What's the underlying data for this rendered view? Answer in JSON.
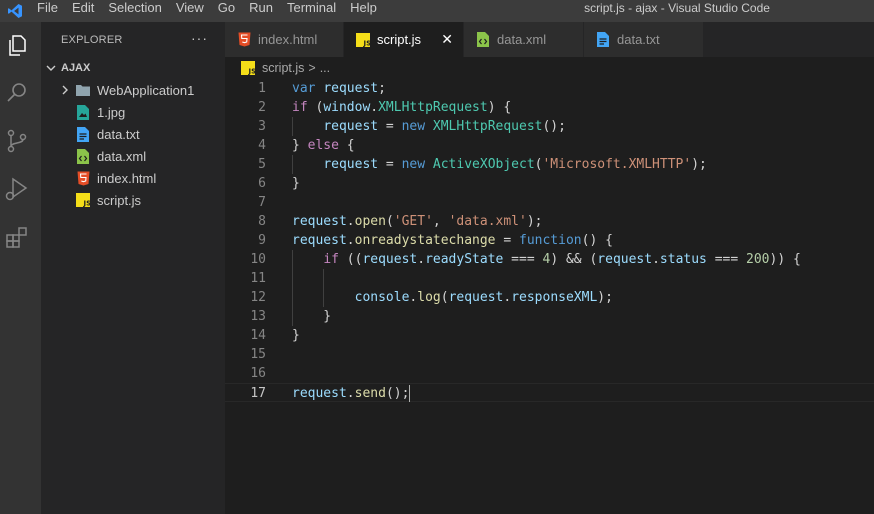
{
  "window": {
    "title": "script.js - ajax - Visual Studio Code"
  },
  "menu": [
    "File",
    "Edit",
    "Selection",
    "View",
    "Go",
    "Run",
    "Terminal",
    "Help"
  ],
  "activity": [
    "explorer-icon",
    "search-icon",
    "source-control-icon",
    "run-debug-icon",
    "extensions-icon"
  ],
  "explorer": {
    "title": "EXPLORER",
    "more": "···",
    "folder": "AJAX",
    "items": [
      {
        "label": "WebApplication1",
        "icon": "folder-icon",
        "color": "#c09553"
      },
      {
        "label": "1.jpg",
        "icon": "image-file-icon",
        "color": "#26a69a"
      },
      {
        "label": "data.txt",
        "icon": "text-file-icon",
        "color": "#42a5f5"
      },
      {
        "label": "data.xml",
        "icon": "xml-file-icon",
        "color": "#8bc34a"
      },
      {
        "label": "index.html",
        "icon": "html-file-icon",
        "color": "#e44d26"
      },
      {
        "label": "script.js",
        "icon": "js-file-icon",
        "color": "#f5de19"
      }
    ]
  },
  "tabs": [
    {
      "label": "index.html",
      "icon": "html-file-icon",
      "active": false
    },
    {
      "label": "script.js",
      "icon": "js-file-icon",
      "active": true,
      "close": "✕"
    },
    {
      "label": "data.xml",
      "icon": "xml-file-icon",
      "active": false
    },
    {
      "label": "data.txt",
      "icon": "text-file-icon",
      "active": false
    }
  ],
  "breadcrumb": {
    "file": "script.js",
    "sep": ">",
    "rest": "..."
  },
  "editor": {
    "current_line": 17,
    "lines": [
      {
        "n": "1",
        "t": [
          [
            "kw",
            "var"
          ],
          [
            "pun",
            " "
          ],
          [
            "var",
            "request"
          ],
          [
            "pun",
            ";"
          ]
        ]
      },
      {
        "n": "2",
        "t": [
          [
            "ctrl",
            "if"
          ],
          [
            "pun",
            " ("
          ],
          [
            "var",
            "window"
          ],
          [
            "pun",
            "."
          ],
          [
            "cls",
            "XMLHttpRequest"
          ],
          [
            "pun",
            ") {"
          ]
        ]
      },
      {
        "n": "3",
        "t": [
          [
            "pun",
            "    "
          ],
          [
            "var",
            "request"
          ],
          [
            "pun",
            " = "
          ],
          [
            "kw",
            "new"
          ],
          [
            "pun",
            " "
          ],
          [
            "cls",
            "XMLHttpRequest"
          ],
          [
            "pun",
            "();"
          ]
        ]
      },
      {
        "n": "4",
        "t": [
          [
            "pun",
            "} "
          ],
          [
            "ctrl",
            "else"
          ],
          [
            "pun",
            " {"
          ]
        ]
      },
      {
        "n": "5",
        "t": [
          [
            "pun",
            "    "
          ],
          [
            "var",
            "request"
          ],
          [
            "pun",
            " = "
          ],
          [
            "kw",
            "new"
          ],
          [
            "pun",
            " "
          ],
          [
            "cls",
            "ActiveXObject"
          ],
          [
            "pun",
            "("
          ],
          [
            "str",
            "'Microsoft.XMLHTTP'"
          ],
          [
            "pun",
            ");"
          ]
        ]
      },
      {
        "n": "6",
        "t": [
          [
            "pun",
            "}"
          ]
        ]
      },
      {
        "n": "7",
        "t": []
      },
      {
        "n": "8",
        "t": [
          [
            "var",
            "request"
          ],
          [
            "pun",
            "."
          ],
          [
            "fn",
            "open"
          ],
          [
            "pun",
            "("
          ],
          [
            "str",
            "'GET'"
          ],
          [
            "pun",
            ", "
          ],
          [
            "str",
            "'data.xml'"
          ],
          [
            "pun",
            ");"
          ]
        ]
      },
      {
        "n": "9",
        "t": [
          [
            "var",
            "request"
          ],
          [
            "pun",
            "."
          ],
          [
            "fn",
            "onreadystatechange"
          ],
          [
            "pun",
            " = "
          ],
          [
            "kw",
            "function"
          ],
          [
            "pun",
            "() {"
          ]
        ]
      },
      {
        "n": "10",
        "t": [
          [
            "pun",
            "    "
          ],
          [
            "ctrl",
            "if"
          ],
          [
            "pun",
            " (("
          ],
          [
            "var",
            "request"
          ],
          [
            "pun",
            "."
          ],
          [
            "var",
            "readyState"
          ],
          [
            "pun",
            " === "
          ],
          [
            "num",
            "4"
          ],
          [
            "pun",
            ") && ("
          ],
          [
            "var",
            "request"
          ],
          [
            "pun",
            "."
          ],
          [
            "var",
            "status"
          ],
          [
            "pun",
            " === "
          ],
          [
            "num",
            "200"
          ],
          [
            "pun",
            ")) {"
          ]
        ]
      },
      {
        "n": "11",
        "t": []
      },
      {
        "n": "12",
        "t": [
          [
            "pun",
            "        "
          ],
          [
            "var",
            "console"
          ],
          [
            "pun",
            "."
          ],
          [
            "fn",
            "log"
          ],
          [
            "pun",
            "("
          ],
          [
            "var",
            "request"
          ],
          [
            "pun",
            "."
          ],
          [
            "var",
            "responseXML"
          ],
          [
            "pun",
            ");"
          ]
        ]
      },
      {
        "n": "13",
        "t": [
          [
            "pun",
            "    }"
          ]
        ]
      },
      {
        "n": "14",
        "t": [
          [
            "pun",
            "}"
          ]
        ]
      },
      {
        "n": "15",
        "t": []
      },
      {
        "n": "16",
        "t": []
      },
      {
        "n": "17",
        "t": [
          [
            "var",
            "request"
          ],
          [
            "pun",
            "."
          ],
          [
            "fn",
            "send"
          ],
          [
            "pun",
            "();"
          ]
        ]
      }
    ]
  }
}
